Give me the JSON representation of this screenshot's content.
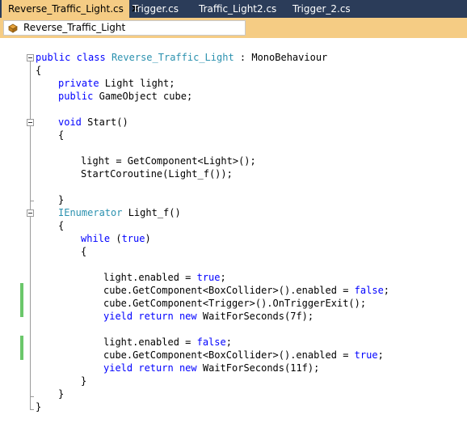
{
  "tabs": [
    {
      "label": "Reverse_Traffic_Light.cs",
      "active": true,
      "closable": true
    },
    {
      "label": "Trigger.cs",
      "active": false
    },
    {
      "label": "Traffic_Light2.cs",
      "active": false
    },
    {
      "label": "Trigger_2.cs",
      "active": false
    }
  ],
  "navbar": {
    "type_label": "Reverse_Traffic_Light",
    "icon": "class-icon"
  },
  "colors": {
    "tabstrip_bg": "#2b3c59",
    "active_tab_bg": "#f5cc84",
    "keyword": "#0000ff",
    "type_name": "#2b91af",
    "change_bar": "#6bc76b"
  },
  "code": {
    "l1": {
      "kw1": "public",
      "kw2": "class",
      "type": "Reverse_Traffic_Light",
      "rest": " : MonoBehaviour"
    },
    "l2": "{",
    "l3": {
      "kw": "private",
      "rest": " Light light;"
    },
    "l4": {
      "kw": "public",
      "rest": " GameObject cube;"
    },
    "l5": {
      "kw": "void",
      "rest": " Start()"
    },
    "l6": "{",
    "l7": "light = GetComponent<Light>();",
    "l8": "StartCoroutine(Light_f());",
    "l9": "}",
    "l10": {
      "type": "IEnumerator",
      "rest": " Light_f()"
    },
    "l11": "{",
    "l12": {
      "kw": "while",
      "mid": " (",
      "kw2": "true",
      "end": ")"
    },
    "l13": "{",
    "l14": {
      "pre": "light.enabled = ",
      "kw": "true",
      "end": ";"
    },
    "l15": {
      "pre": "cube.GetComponent<BoxCollider>().enabled = ",
      "kw": "false",
      "end": ";"
    },
    "l16": "cube.GetComponent<Trigger>().OnTriggerExit();",
    "l17": {
      "kw1": "yield",
      "kw2": "return",
      "kw3": "new",
      "rest": " WaitForSeconds(7f);"
    },
    "l18": {
      "pre": "light.enabled = ",
      "kw": "false",
      "end": ";"
    },
    "l19": {
      "pre": "cube.GetComponent<BoxCollider>().enabled = ",
      "kw": "true",
      "end": ";"
    },
    "l20": {
      "kw1": "yield",
      "kw2": "return",
      "kw3": "new",
      "rest": " WaitForSeconds(11f);"
    },
    "l21": "}",
    "l22": "}",
    "l23": "}"
  }
}
